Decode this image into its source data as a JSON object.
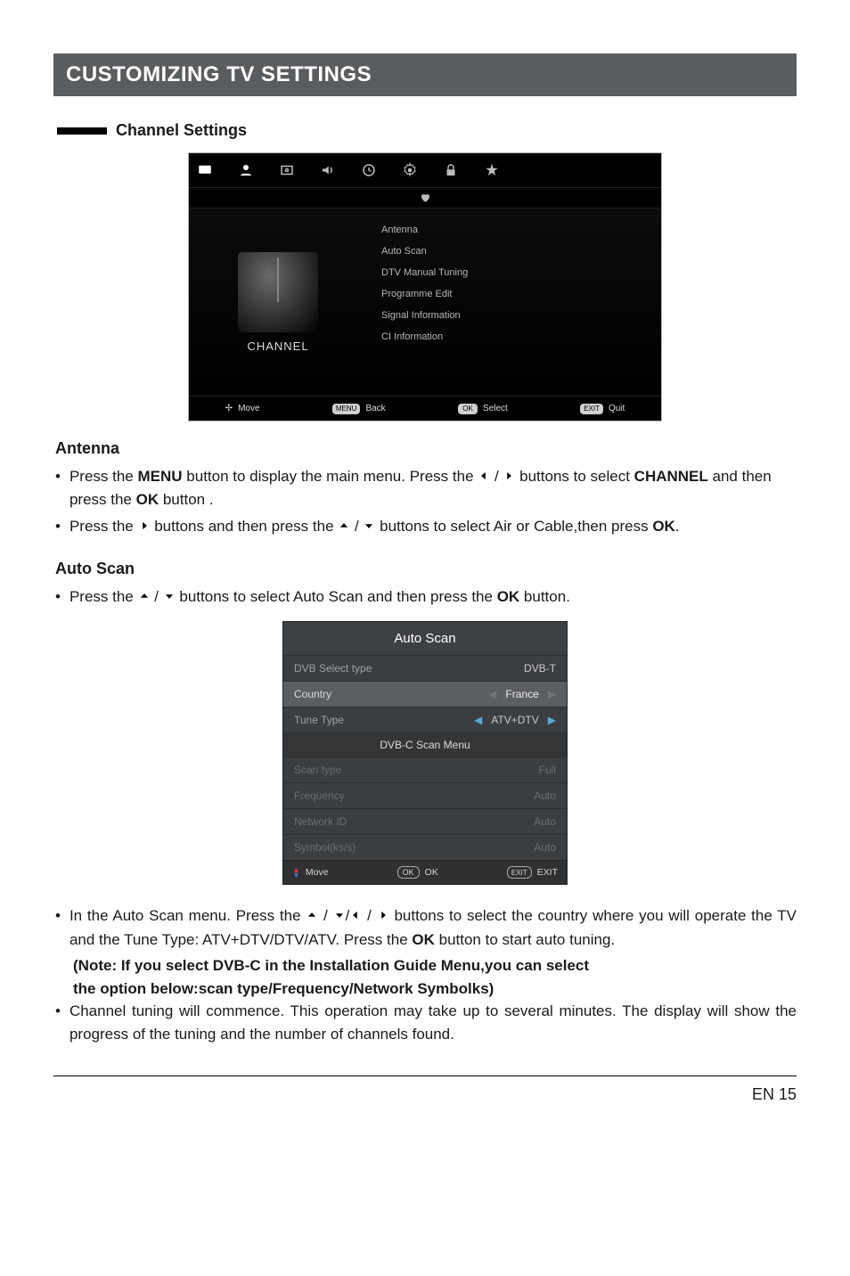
{
  "banner": "CUSTOMIZING TV SETTINGS",
  "section_title": "Channel Settings",
  "osd1": {
    "left_label": "CHANNEL",
    "items": [
      "Antenna",
      "Auto Scan",
      "DTV Manual Tuning",
      "Programme Edit",
      "Signal Information",
      "CI Information"
    ],
    "footer": {
      "move": "Move",
      "back": "Back",
      "select": "Select",
      "quit": "Quit",
      "menu_key": "MENU",
      "ok_key": "OK",
      "exit_key": "EXIT"
    }
  },
  "antenna": {
    "heading": "Antenna",
    "b1a": "Press the ",
    "b1b": "MENU",
    "b1c": " button to display the main menu. Press the ",
    "b1d": " buttons to select ",
    "b1e": "CHANNEL",
    "b1f": " and then press the ",
    "b1g": "OK",
    "b1h": " button .",
    "b2a": "Press the ",
    "b2b": " buttons and then press the ",
    "b2c": " buttons to select Air or Cable,then press ",
    "b2d": "OK",
    "b2e": "."
  },
  "autoscan": {
    "heading": "Auto Scan",
    "b1a": "Press the ",
    "b1b": " buttons to select Auto Scan and then press the ",
    "b1c": "OK",
    "b1d": " button."
  },
  "osd2": {
    "title": "Auto Scan",
    "rows": {
      "dvb_label": "DVB Select type",
      "dvb_val": "DVB-T",
      "country_label": "Country",
      "country_val": "France",
      "tune_label": "Tune Type",
      "tune_val": "ATV+DTV"
    },
    "section": "DVB-C Scan Menu",
    "dim_rows": {
      "scan_label": "Scan type",
      "scan_val": "Full",
      "freq_label": "Frequency",
      "freq_val": "Auto",
      "net_label": "Network ID",
      "net_val": "Auto",
      "sym_label": "Symbol(ks/s)",
      "sym_val": "Auto"
    },
    "footer": {
      "move": "Move",
      "ok": "OK",
      "exit": "EXIT",
      "ok_key": "OK",
      "exit_key": "EXIT"
    }
  },
  "post": {
    "b1a": "In the Auto Scan menu. Press the ",
    "b1b": " buttons to select the country where you will operate the TV and the Tune Type: ATV+DTV/DTV/ATV. Press the ",
    "b1c": "OK",
    "b1d": " button to start auto tuning.",
    "note1": "(Note: If you select DVB-C in the Installation Guide Menu,you can select",
    "note2": " the option  below:scan type/Frequency/Network Symbolks)",
    "b2": "Channel tuning will commence. This operation may take up to several minutes. The display will show the progress of the tuning and the number of channels found."
  },
  "page_num": "EN 15"
}
